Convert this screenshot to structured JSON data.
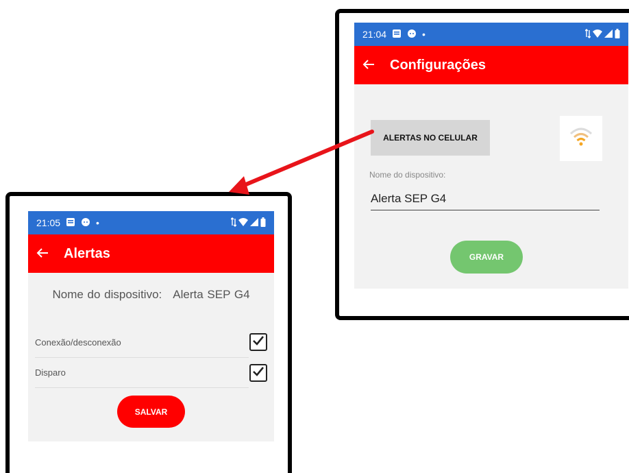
{
  "config_screen": {
    "status_time": "21:04",
    "app_title": "Configurações",
    "alerts_button_label": "ALERTAS NO CELULAR",
    "wifi_icon": "wifi-icon",
    "device_name_label": "Nome do dispositivo:",
    "device_name_value": "Alerta SEP G4",
    "save_button_label": "GRAVAR"
  },
  "alerts_screen": {
    "status_time": "21:05",
    "app_title": "Alertas",
    "device_name_label": "Nome do dispositivo:",
    "device_name_value": "Alerta SEP G4",
    "options": [
      {
        "label": "Conexão/desconexão",
        "checked": true
      },
      {
        "label": "Disparo",
        "checked": true
      }
    ],
    "save_button_label": "SALVAR"
  },
  "colors": {
    "appbar": "#ff0000",
    "statusbar": "#2a6fd1",
    "gravar": "#74c66f",
    "salvar": "#ff0000",
    "arrow": "#e8141a",
    "wifi": "#f5a623"
  }
}
